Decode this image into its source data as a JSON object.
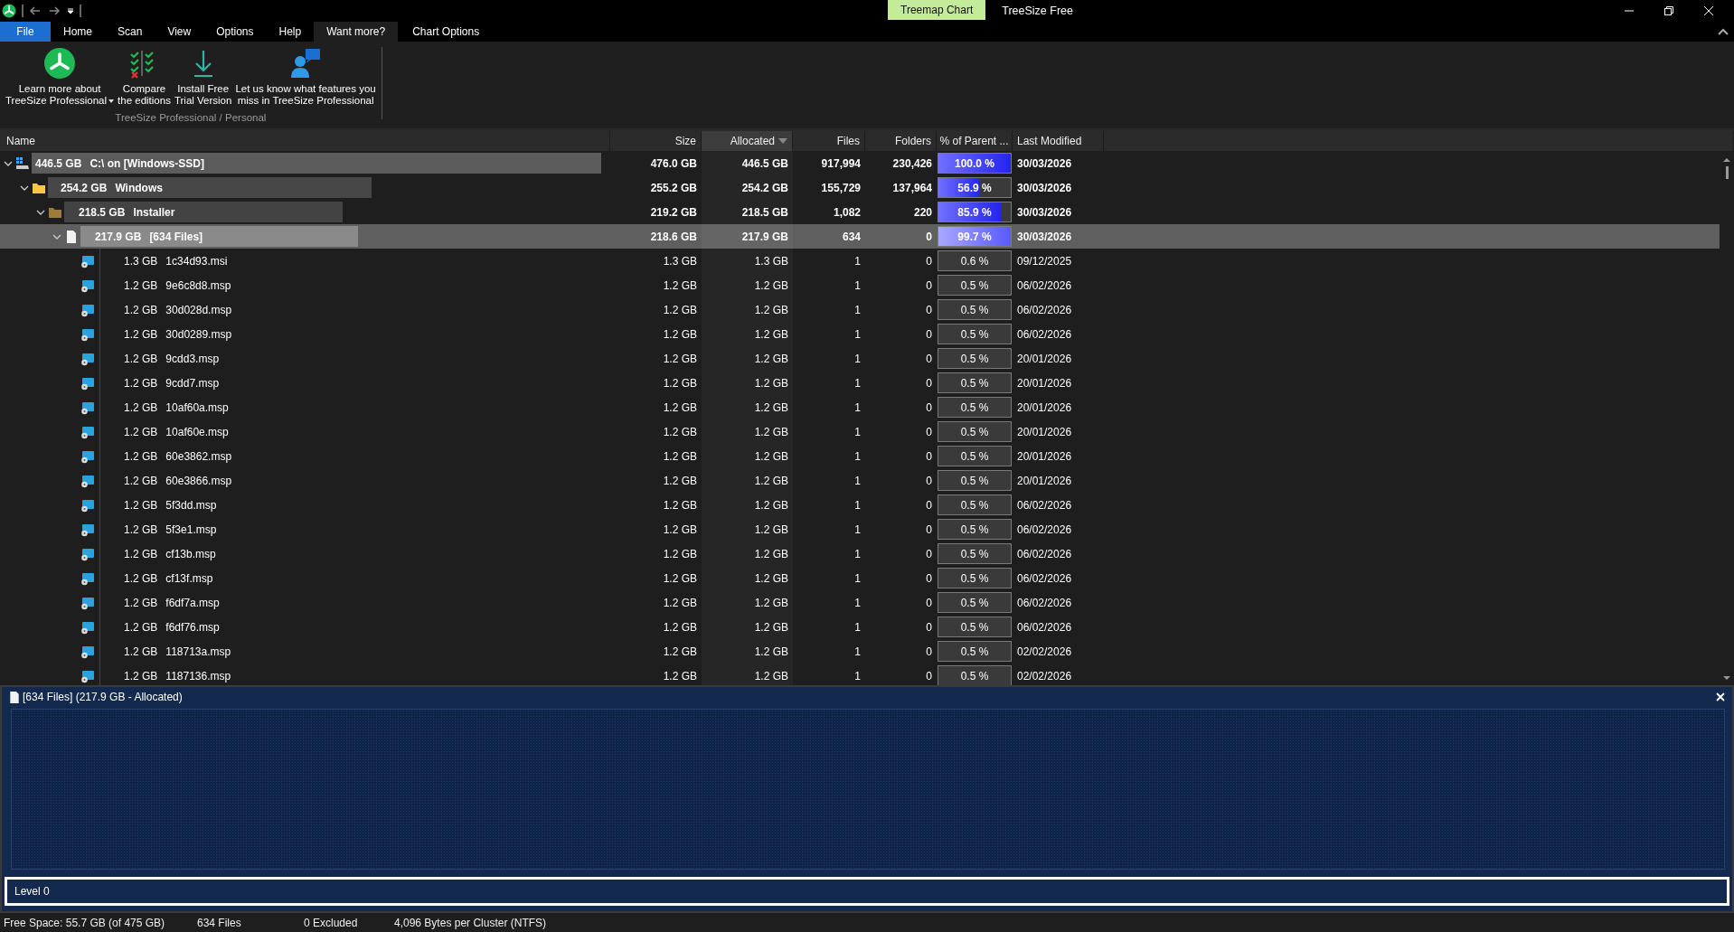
{
  "title_bar": {
    "app_title": "TreeSize Free",
    "context_group": "Treemap Chart"
  },
  "ribbon_tabs": [
    {
      "label": "File",
      "kind": "app",
      "selected": false
    },
    {
      "label": "Home",
      "kind": "tab",
      "selected": false
    },
    {
      "label": "Scan",
      "kind": "tab",
      "selected": false
    },
    {
      "label": "View",
      "kind": "tab",
      "selected": false
    },
    {
      "label": "Options",
      "kind": "tab",
      "selected": false
    },
    {
      "label": "Help",
      "kind": "tab",
      "selected": false
    },
    {
      "label": "Want more?",
      "kind": "tab",
      "selected": true
    },
    {
      "label": "Chart Options",
      "kind": "context",
      "selected": false
    }
  ],
  "ribbon": {
    "group_label": "TreeSize Professional / Personal",
    "buttons": [
      {
        "label": "Learn more about\nTreeSize Professional",
        "kind": "logo",
        "dropdown": true
      },
      {
        "label": "Compare\nthe editions",
        "kind": "compare",
        "dropdown": false
      },
      {
        "label": "Install Free\nTrial Version",
        "kind": "download",
        "dropdown": false
      },
      {
        "label": "Let us know what features you\nmiss in TreeSize Professional",
        "kind": "feedback",
        "dropdown": false
      }
    ]
  },
  "table": {
    "columns": [
      {
        "label": "Name",
        "sorted": false
      },
      {
        "label": "Size",
        "sorted": false
      },
      {
        "label": "Allocated",
        "sorted": true
      },
      {
        "label": "Files",
        "sorted": false
      },
      {
        "label": "Folders",
        "sorted": false
      },
      {
        "label": "% of Parent ...",
        "sorted": false
      },
      {
        "label": "Last Modified",
        "sorted": false
      }
    ],
    "rows": [
      {
        "kind": "drive",
        "size_label": "446.5 GB",
        "name": "C:\\  on  [Windows-SSD]",
        "size": "476.0 GB",
        "allocated": "446.5 GB",
        "files": "917,994",
        "folders": "230,426",
        "percent": "100.0 %",
        "level": 1.0,
        "modified": "30/03/2026",
        "expanded": true,
        "selected": false,
        "children": [
          {
            "kind": "folder",
            "size_label": "254.2 GB",
            "name": "Windows",
            "size": "255.2 GB",
            "allocated": "254.2 GB",
            "files": "155,729",
            "folders": "137,964",
            "percent": "56.9 %",
            "level": 0.569,
            "modified": "30/03/2026",
            "expanded": true,
            "selected": false,
            "children": [
              {
                "kind": "system_folder",
                "size_label": "218.5 GB",
                "name": "Installer",
                "size": "219.2 GB",
                "allocated": "218.5 GB",
                "files": "1,082",
                "folders": "220",
                "percent": "85.9 %",
                "level": 0.859,
                "modified": "30/03/2026",
                "expanded": true,
                "selected": false,
                "children": [
                  {
                    "kind": "files",
                    "size_label": "217.9 GB",
                    "name": "[634 Files]",
                    "size": "218.6 GB",
                    "allocated": "217.9 GB",
                    "files": "634",
                    "folders": "0",
                    "percent": "99.7 %",
                    "level": 0.997,
                    "modified": "30/03/2026",
                    "expanded": true,
                    "selected": true,
                    "children": [
                      {
                        "kind": "file",
                        "size_label": "1.3 GB",
                        "name": "1c34d93.msi",
                        "size": "1.3 GB",
                        "allocated": "1.3 GB",
                        "files": "1",
                        "folders": "0",
                        "percent": "0.6 %",
                        "level": 0.006,
                        "modified": "09/12/2025",
                        "selected": false
                      },
                      {
                        "kind": "file",
                        "size_label": "1.2 GB",
                        "name": "9e6c8d8.msp",
                        "size": "1.2 GB",
                        "allocated": "1.2 GB",
                        "files": "1",
                        "folders": "0",
                        "percent": "0.5 %",
                        "level": 0.005,
                        "modified": "06/02/2026",
                        "selected": false
                      },
                      {
                        "kind": "file",
                        "size_label": "1.2 GB",
                        "name": "30d028d.msp",
                        "size": "1.2 GB",
                        "allocated": "1.2 GB",
                        "files": "1",
                        "folders": "0",
                        "percent": "0.5 %",
                        "level": 0.005,
                        "modified": "06/02/2026",
                        "selected": false
                      },
                      {
                        "kind": "file",
                        "size_label": "1.2 GB",
                        "name": "30d0289.msp",
                        "size": "1.2 GB",
                        "allocated": "1.2 GB",
                        "files": "1",
                        "folders": "0",
                        "percent": "0.5 %",
                        "level": 0.005,
                        "modified": "06/02/2026",
                        "selected": false
                      },
                      {
                        "kind": "file",
                        "size_label": "1.2 GB",
                        "name": "9cdd3.msp",
                        "size": "1.2 GB",
                        "allocated": "1.2 GB",
                        "files": "1",
                        "folders": "0",
                        "percent": "0.5 %",
                        "level": 0.005,
                        "modified": "20/01/2026",
                        "selected": false
                      },
                      {
                        "kind": "file",
                        "size_label": "1.2 GB",
                        "name": "9cdd7.msp",
                        "size": "1.2 GB",
                        "allocated": "1.2 GB",
                        "files": "1",
                        "folders": "0",
                        "percent": "0.5 %",
                        "level": 0.005,
                        "modified": "20/01/2026",
                        "selected": false
                      },
                      {
                        "kind": "file",
                        "size_label": "1.2 GB",
                        "name": "10af60a.msp",
                        "size": "1.2 GB",
                        "allocated": "1.2 GB",
                        "files": "1",
                        "folders": "0",
                        "percent": "0.5 %",
                        "level": 0.005,
                        "modified": "20/01/2026",
                        "selected": false
                      },
                      {
                        "kind": "file",
                        "size_label": "1.2 GB",
                        "name": "10af60e.msp",
                        "size": "1.2 GB",
                        "allocated": "1.2 GB",
                        "files": "1",
                        "folders": "0",
                        "percent": "0.5 %",
                        "level": 0.005,
                        "modified": "20/01/2026",
                        "selected": false
                      },
                      {
                        "kind": "file",
                        "size_label": "1.2 GB",
                        "name": "60e3862.msp",
                        "size": "1.2 GB",
                        "allocated": "1.2 GB",
                        "files": "1",
                        "folders": "0",
                        "percent": "0.5 %",
                        "level": 0.005,
                        "modified": "20/01/2026",
                        "selected": false
                      },
                      {
                        "kind": "file",
                        "size_label": "1.2 GB",
                        "name": "60e3866.msp",
                        "size": "1.2 GB",
                        "allocated": "1.2 GB",
                        "files": "1",
                        "folders": "0",
                        "percent": "0.5 %",
                        "level": 0.005,
                        "modified": "20/01/2026",
                        "selected": false
                      },
                      {
                        "kind": "file",
                        "size_label": "1.2 GB",
                        "name": "5f3dd.msp",
                        "size": "1.2 GB",
                        "allocated": "1.2 GB",
                        "files": "1",
                        "folders": "0",
                        "percent": "0.5 %",
                        "level": 0.005,
                        "modified": "06/02/2026",
                        "selected": false
                      },
                      {
                        "kind": "file",
                        "size_label": "1.2 GB",
                        "name": "5f3e1.msp",
                        "size": "1.2 GB",
                        "allocated": "1.2 GB",
                        "files": "1",
                        "folders": "0",
                        "percent": "0.5 %",
                        "level": 0.005,
                        "modified": "06/02/2026",
                        "selected": false
                      },
                      {
                        "kind": "file",
                        "size_label": "1.2 GB",
                        "name": "cf13b.msp",
                        "size": "1.2 GB",
                        "allocated": "1.2 GB",
                        "files": "1",
                        "folders": "0",
                        "percent": "0.5 %",
                        "level": 0.005,
                        "modified": "06/02/2026",
                        "selected": false
                      },
                      {
                        "kind": "file",
                        "size_label": "1.2 GB",
                        "name": "cf13f.msp",
                        "size": "1.2 GB",
                        "allocated": "1.2 GB",
                        "files": "1",
                        "folders": "0",
                        "percent": "0.5 %",
                        "level": 0.005,
                        "modified": "06/02/2026",
                        "selected": false
                      },
                      {
                        "kind": "file",
                        "size_label": "1.2 GB",
                        "name": "f6df7a.msp",
                        "size": "1.2 GB",
                        "allocated": "1.2 GB",
                        "files": "1",
                        "folders": "0",
                        "percent": "0.5 %",
                        "level": 0.005,
                        "modified": "06/02/2026",
                        "selected": false
                      },
                      {
                        "kind": "file",
                        "size_label": "1.2 GB",
                        "name": "f6df76.msp",
                        "size": "1.2 GB",
                        "allocated": "1.2 GB",
                        "files": "1",
                        "folders": "0",
                        "percent": "0.5 %",
                        "level": 0.005,
                        "modified": "06/02/2026",
                        "selected": false
                      },
                      {
                        "kind": "file",
                        "size_label": "1.2 GB",
                        "name": "118713a.msp",
                        "size": "1.2 GB",
                        "allocated": "1.2 GB",
                        "files": "1",
                        "folders": "0",
                        "percent": "0.5 %",
                        "level": 0.005,
                        "modified": "02/02/2026",
                        "selected": false
                      },
                      {
                        "kind": "file",
                        "size_label": "1.2 GB",
                        "name": "1187136.msp",
                        "size": "1.2 GB",
                        "allocated": "1.2 GB",
                        "files": "1",
                        "folders": "0",
                        "percent": "0.5 %",
                        "level": 0.005,
                        "modified": "02/02/2026",
                        "selected": false
                      }
                    ]
                  }
                ]
              }
            ]
          }
        ]
      }
    ]
  },
  "treemap": {
    "title": "[634 Files] (217.9 GB - Allocated)",
    "level_label": "Level 0"
  },
  "status_bar": [
    "Free Space: 55.7 GB  (of 475 GB)",
    "634 Files",
    "0 Excluded",
    "4,096 Bytes per Cluster (NTFS)"
  ]
}
